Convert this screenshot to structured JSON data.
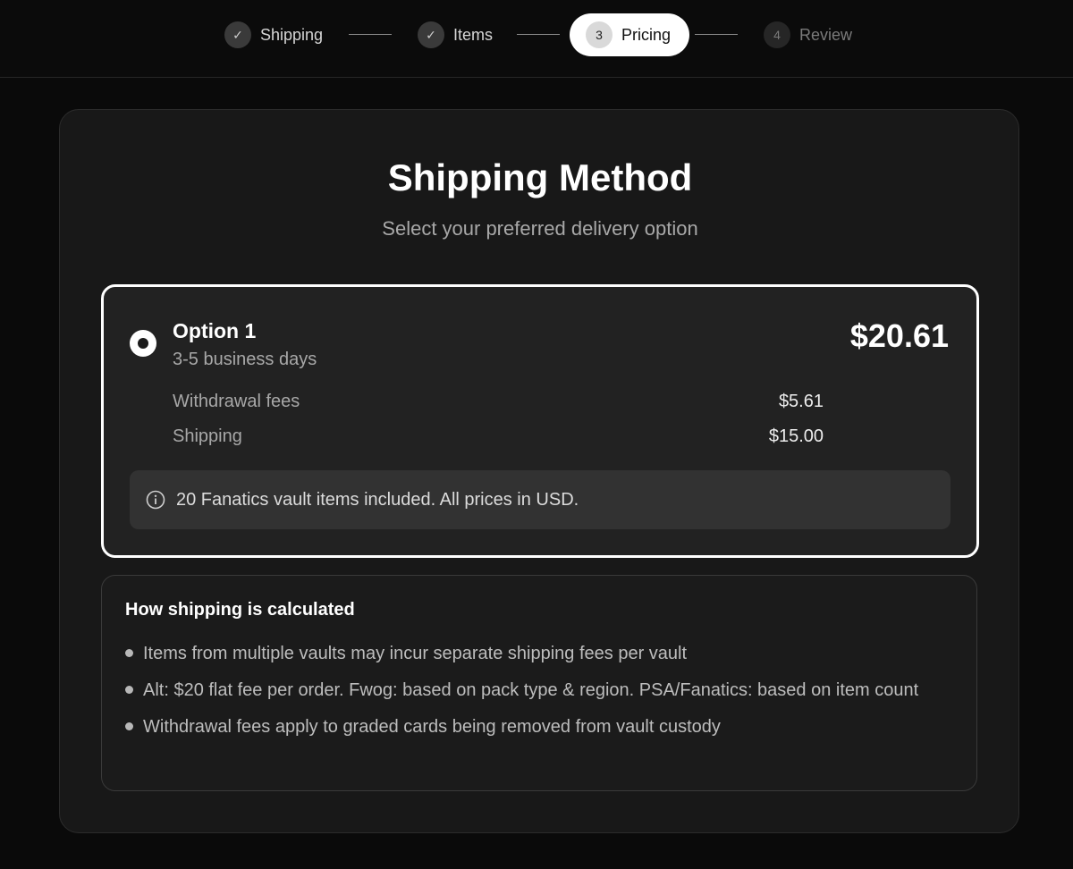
{
  "stepper": {
    "steps": [
      {
        "label": "Shipping",
        "marker": "✓",
        "state": "complete"
      },
      {
        "label": "Items",
        "marker": "✓",
        "state": "complete"
      },
      {
        "label": "Pricing",
        "marker": "3",
        "state": "active"
      },
      {
        "label": "Review",
        "marker": "4",
        "state": "upcoming"
      }
    ]
  },
  "header": {
    "title": "Shipping Method",
    "subtitle": "Select your preferred delivery option"
  },
  "option": {
    "name": "Option 1",
    "eta": "3-5 business days",
    "price": "$20.61",
    "selected": true,
    "fees": [
      {
        "label": "Withdrawal fees",
        "value": "$5.61"
      },
      {
        "label": "Shipping",
        "value": "$15.00"
      }
    ],
    "notice_icon": "info-icon",
    "notice": "20 Fanatics vault items included. All prices in USD."
  },
  "info": {
    "title": "How shipping is calculated",
    "bullets": [
      "Items from multiple vaults may incur separate shipping fees per vault",
      "Alt: $20 flat fee per order. Fwog: based on pack type & region. PSA/Fanatics: based on item count",
      "Withdrawal fees apply to graded cards being removed from vault custody"
    ]
  },
  "colors": {
    "background": "#0a0a0a",
    "card": "#181818",
    "option_card": "#222222",
    "accent": "#ffffff"
  }
}
